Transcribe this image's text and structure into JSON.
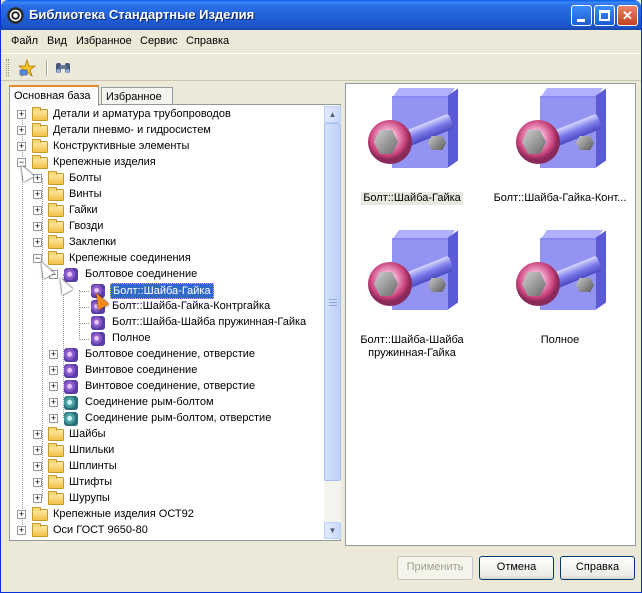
{
  "window": {
    "title": "Библиотека Стандартные Изделия"
  },
  "menu": [
    "Файл",
    "Вид",
    "Избранное",
    "Сервис",
    "Справка"
  ],
  "toolbar": {
    "icons": [
      "favorite-star-icon",
      "binoculars-icon"
    ]
  },
  "tabs": [
    {
      "label": "Основная база",
      "active": true
    },
    {
      "label": "Избранное",
      "active": false
    }
  ],
  "tree": {
    "rows": [
      {
        "label": "Детали и арматура трубопроводов",
        "expander": "+"
      },
      {
        "label": "Детали пневмо- и гидросистем",
        "expander": "+"
      },
      {
        "label": "Конструктивные элементы",
        "expander": "+"
      },
      {
        "label": "Крепежные изделия",
        "expander": "-"
      },
      {
        "label": "Болты",
        "expander": "+"
      },
      {
        "label": "Винты",
        "expander": "+"
      },
      {
        "label": "Гайки",
        "expander": "+"
      },
      {
        "label": "Гвозди",
        "expander": "+"
      },
      {
        "label": "Заклепки",
        "expander": "+"
      },
      {
        "label": "Крепежные соединения",
        "expander": "-"
      },
      {
        "label": "Болтовое соединение",
        "expander": "-"
      },
      {
        "label": "Болт::Шайба-Гайка",
        "selected": true
      },
      {
        "label": "Болт::Шайба-Гайка-Контргайка"
      },
      {
        "label": "Болт::Шайба-Шайба пружинная-Гайка"
      },
      {
        "label": "Полное"
      },
      {
        "label": "Болтовое соединение, отверстие",
        "expander": "+"
      },
      {
        "label": "Винтовое соединение",
        "expander": "+"
      },
      {
        "label": "Винтовое соединение, отверстие",
        "expander": "+"
      },
      {
        "label": "Соединение рым-болтом",
        "expander": "+"
      },
      {
        "label": "Соединение рым-болтом, отверстие",
        "expander": "+"
      },
      {
        "label": "Шайбы",
        "expander": "+"
      },
      {
        "label": "Шпильки",
        "expander": "+"
      },
      {
        "label": "Шплинты",
        "expander": "+"
      },
      {
        "label": "Штифты",
        "expander": "+"
      },
      {
        "label": "Шурупы",
        "expander": "+"
      },
      {
        "label": "Крепежные изделия ОСТ92",
        "expander": "+"
      },
      {
        "label": "Оси ГОСТ 9650-80",
        "expander": "+"
      }
    ]
  },
  "preview": {
    "items": [
      {
        "label": "Болт::Шайба-Гайка",
        "selected": true
      },
      {
        "label": "Болт::Шайба-Гайка-Конт..."
      },
      {
        "label": "Болт::Шайба-Шайба пружинная-Гайка"
      },
      {
        "label": "Полное"
      }
    ]
  },
  "buttons": {
    "apply": "Применить",
    "cancel": "Отмена",
    "help": "Справка"
  },
  "colors": {
    "title_bar": "#1f5fd8",
    "selection": "#316ac5",
    "window_bg": "#ece9d8"
  }
}
